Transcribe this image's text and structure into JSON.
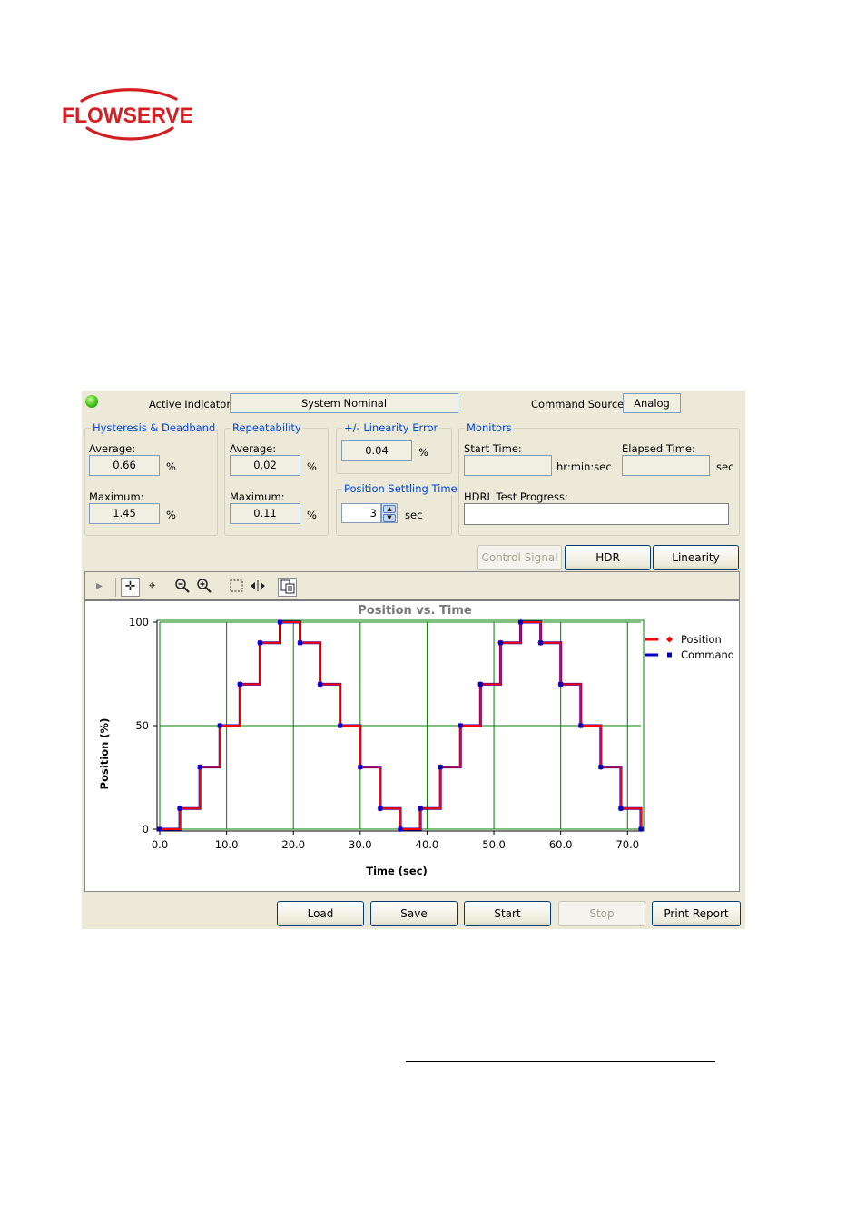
{
  "logo": {
    "text": "FLOWSERVE",
    "color": "#d41e22"
  },
  "header": {
    "active_indicator_label": "Active Indicator:",
    "active_indicator_value": "System Nominal",
    "command_source_label": "Command Source:",
    "command_source_value": "Analog",
    "led_icon": "green-led-icon"
  },
  "hysteresis": {
    "title": "Hysteresis & Deadband",
    "average_label": "Average:",
    "average": "0.66",
    "maximum_label": "Maximum:",
    "maximum": "1.45",
    "unit": "%"
  },
  "repeatability": {
    "title": "Repeatability",
    "average_label": "Average:",
    "average": "0.02",
    "maximum_label": "Maximum:",
    "maximum": "0.11",
    "unit": "%"
  },
  "linearity": {
    "title": "+/- Linearity Error",
    "value": "0.04",
    "unit": "%"
  },
  "settling": {
    "title": "Position Settling Time",
    "value": "3",
    "unit": "sec"
  },
  "monitors": {
    "title": "Monitors",
    "start_label": "Start Time:",
    "start_value": "",
    "start_unit": "hr:min:sec",
    "elapsed_label": "Elapsed Time:",
    "elapsed_value": "",
    "elapsed_unit": "sec",
    "progress_label": "HDRL Test Progress:",
    "progress": 0
  },
  "tabs": {
    "control_signal": "Control Signal",
    "hdr": "HDR",
    "linearity": "Linearity"
  },
  "toolbar_icons": [
    "play-icon",
    "pan-icon",
    "zoom-area-icon",
    "zoom-out-icon",
    "zoom-in-icon",
    "select-box-icon",
    "cursor-icon",
    "copy-icon"
  ],
  "buttons": {
    "load": "Load",
    "save": "Save",
    "start": "Start",
    "stop": "Stop",
    "print": "Print Report"
  },
  "colors": {
    "window_bg": "#ece9d8",
    "position": "#ff0000",
    "command": "#0000cc",
    "grid": "#008000",
    "group_title": "#0046d5"
  },
  "chart_data": {
    "type": "line",
    "title": "Position vs. Time",
    "xlabel": "Time (sec)",
    "ylabel": "Position (%)",
    "xlim": [
      0,
      72
    ],
    "ylim": [
      0,
      100
    ],
    "x_ticks": [
      0,
      10,
      20,
      30,
      40,
      50,
      60,
      70
    ],
    "x_tick_labels": [
      "0.0",
      "10.0",
      "20.0",
      "30.0",
      "40.0",
      "50.0",
      "60.0",
      "70.0"
    ],
    "y_ticks": [
      0,
      50,
      100
    ],
    "y_tick_labels": [
      "0",
      "50",
      "100"
    ],
    "grid": true,
    "legend_position": "top-right",
    "series": [
      {
        "name": "Position",
        "color": "#ff0000",
        "step": true,
        "x": [
          0,
          3,
          6,
          9,
          12,
          15,
          18,
          21,
          24,
          27,
          30,
          33,
          36,
          39,
          42,
          45,
          48,
          51,
          54,
          57,
          60,
          63,
          66,
          69,
          72
        ],
        "y": [
          0,
          10,
          30,
          50,
          70,
          90,
          100,
          90,
          70,
          50,
          30,
          10,
          0,
          10,
          30,
          50,
          70,
          90,
          100,
          90,
          70,
          50,
          30,
          10,
          0
        ]
      },
      {
        "name": "Command",
        "color": "#0000cc",
        "step": true,
        "x": [
          0,
          3,
          6,
          9,
          12,
          15,
          18,
          21,
          24,
          27,
          30,
          33,
          36,
          39,
          42,
          45,
          48,
          51,
          54,
          57,
          60,
          63,
          66,
          69,
          72
        ],
        "y": [
          0,
          10,
          30,
          50,
          70,
          90,
          100,
          90,
          70,
          50,
          30,
          10,
          0,
          10,
          30,
          50,
          70,
          90,
          100,
          90,
          70,
          50,
          30,
          10,
          0
        ]
      }
    ]
  }
}
